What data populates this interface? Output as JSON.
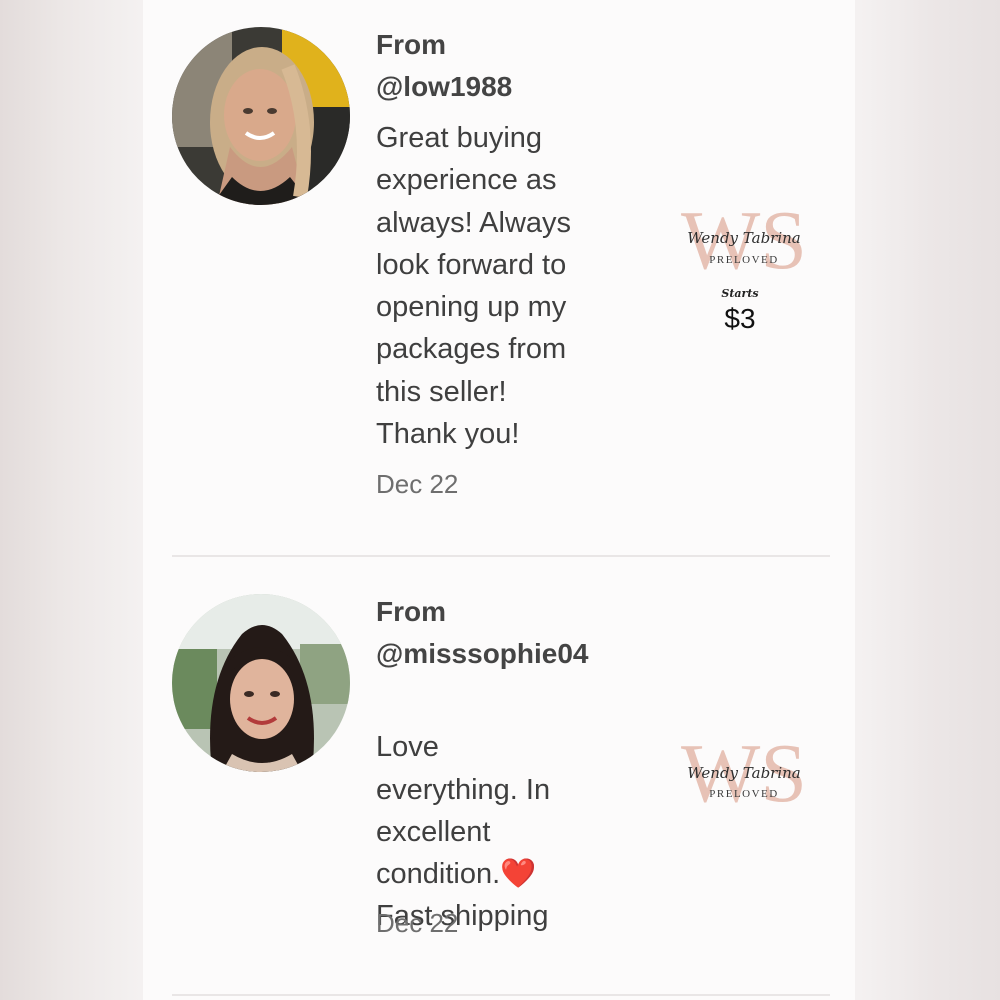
{
  "reviews": [
    {
      "from_label": "From",
      "username": "@low1988",
      "body": "Great buying\nexperience as\nalways! Always\nlook forward to\nopening up my\npackages from\nthis seller!\nThank you!",
      "date": "Dec 22",
      "thumbnail": {
        "logo_letters": "WS",
        "script_text": "Wendy Tabrina",
        "brand_text": "PRELOVED",
        "starts_label": "Starts",
        "price": "$3"
      }
    },
    {
      "from_label": "From",
      "username": "@misssophie04",
      "body_before_icon": "Love\neverything. In\nexcellent\ncondition.",
      "body_icon": "❤️",
      "body_after_icon": "Fast shipping",
      "date": "Dec 22",
      "thumbnail": {
        "logo_letters": "WS",
        "script_text": "Wendy Tabrina",
        "brand_text": "PRELOVED"
      }
    }
  ],
  "colors": {
    "logo_pink": "#e7c2b6",
    "text_dark": "#3f3f3f",
    "heart": "#e0232c"
  }
}
